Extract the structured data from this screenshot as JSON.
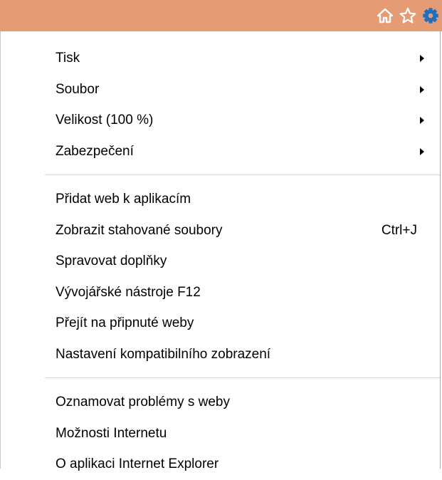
{
  "toolbar": {
    "background": "#e59b74",
    "icons": [
      {
        "name": "home-icon"
      },
      {
        "name": "star-icon"
      },
      {
        "name": "gear-icon",
        "color": "#1e6fbf"
      }
    ]
  },
  "menu": {
    "groups": [
      [
        {
          "label": "Tisk",
          "submenu": true
        },
        {
          "label": "Soubor",
          "submenu": true
        },
        {
          "label": "Velikost (100 %)",
          "submenu": true
        },
        {
          "label": "Zabezpečení",
          "submenu": true
        }
      ],
      [
        {
          "label": "Přidat web k aplikacím"
        },
        {
          "label": "Zobrazit stahované soubory",
          "shortcut": "Ctrl+J"
        },
        {
          "label": "Spravovat doplňky"
        },
        {
          "label": "Vývojářské nástroje F12"
        },
        {
          "label": "Přejít na připnuté weby"
        },
        {
          "label": "Nastavení kompatibilního zobrazení"
        }
      ],
      [
        {
          "label": "Oznamovat problémy s weby"
        },
        {
          "label": "Možnosti Internetu"
        },
        {
          "label": "O aplikaci Internet Explorer"
        }
      ]
    ]
  }
}
